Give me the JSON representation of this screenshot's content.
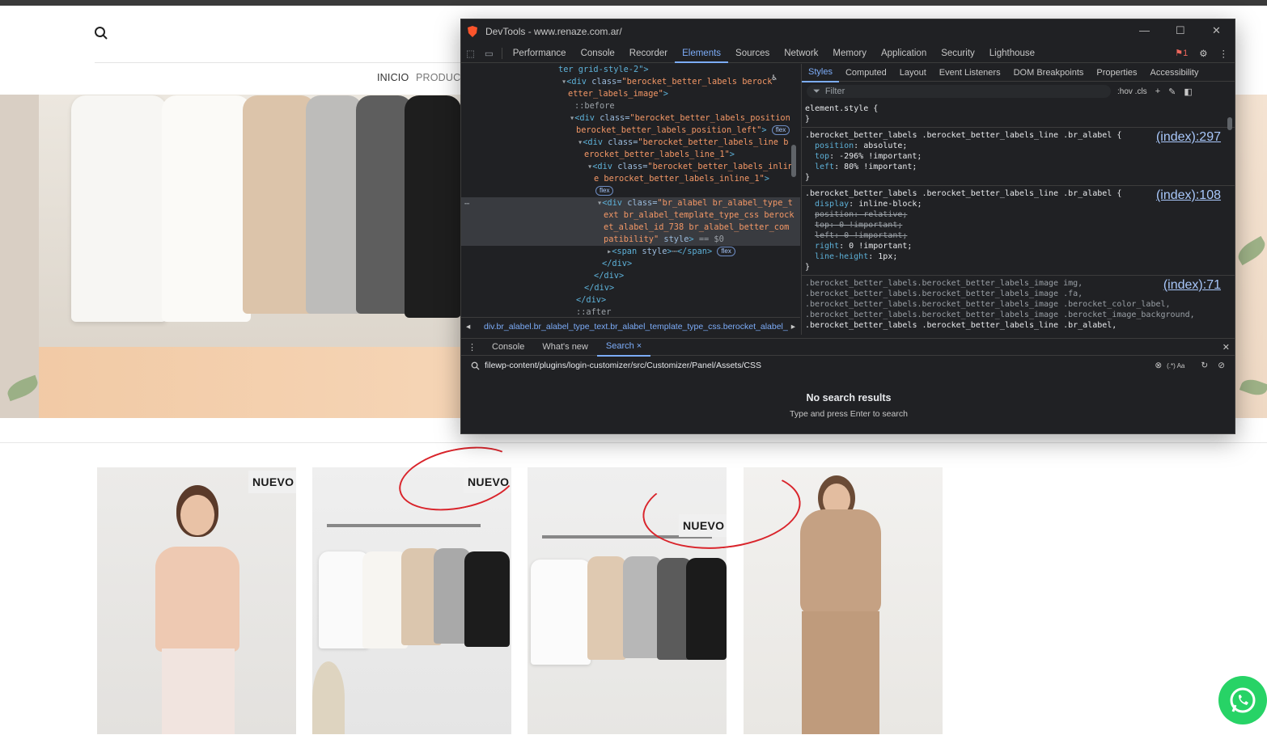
{
  "site": {
    "nav": [
      "INICIO",
      "PRODUCTO"
    ],
    "badges": [
      "NUEVO",
      "NUEVO",
      "NUEVO"
    ]
  },
  "devtools": {
    "title": "DevTools - www.renaze.com.ar/",
    "tabs": [
      "Performance",
      "Console",
      "Recorder",
      "Elements",
      "Sources",
      "Network",
      "Memory",
      "Application",
      "Security",
      "Lighthouse"
    ],
    "issues_count": "1",
    "elements": [
      {
        "indent": 120,
        "html": "<span class='tag'>ter grid-style-2\"&gt;</span>"
      },
      {
        "indent": 124,
        "html": "<span class='gr'>▾</span><span class='tag'>&lt;div</span> <span class='att'>class=</span><span class='val'>\"berocket_better_labels berock</span>"
      },
      {
        "indent": 132,
        "html": "<span class='val'>etter_labels_image\"</span><span class='tag'>&gt;</span>"
      },
      {
        "indent": 140,
        "html": "<span class='gr'>::before</span>"
      },
      {
        "indent": 134,
        "html": "<span class='gr'>▾</span><span class='tag'>&lt;div</span> <span class='att'>class=</span><span class='val'>\"berocket_better_labels_position</span>"
      },
      {
        "indent": 142,
        "html": "<span class='val'>berocket_better_labels_position_left\"</span><span class='tag'>&gt;</span> <span class='pill'>flex</span>"
      },
      {
        "indent": 144,
        "html": "<span class='gr'>▾</span><span class='tag'>&lt;div</span> <span class='att'>class=</span><span class='val'>\"berocket_better_labels_line b</span>"
      },
      {
        "indent": 152,
        "html": "<span class='val'>erocket_better_labels_line_1\"</span><span class='tag'>&gt;</span>"
      },
      {
        "indent": 156,
        "html": "<span class='gr'>▾</span><span class='tag'>&lt;div</span> <span class='att'>class=</span><span class='val'>\"berocket_better_labels_inlin</span>"
      },
      {
        "indent": 164,
        "html": "<span class='val'>e berocket_better_labels_inline_1\"</span><span class='tag'>&gt;</span>"
      },
      {
        "indent": 166,
        "html": "<span class='pill'>flex</span>"
      },
      {
        "indent": 168,
        "sel": true,
        "html": "<span class='gr'>▾</span><span class='tag'>&lt;div</span> <span class='att'>class=</span><span class='val'>\"br_alabel br_alabel_type_t</span>"
      },
      {
        "indent": 176,
        "sel": true,
        "html": "<span class='val'>ext br_alabel_template_type_css berock</span>"
      },
      {
        "indent": 176,
        "sel": true,
        "html": "<span class='val'>et_alabel_id_738  br_alabel_better_com</span>"
      },
      {
        "indent": 176,
        "sel": true,
        "html": "<span class='val'>patibility\"</span> <span class='att'>style</span><span class='tag'>&gt;</span> <span class='gr'>== $0</span>"
      },
      {
        "indent": 180,
        "html": "<span class='gr'>▸</span><span class='tag'>&lt;span</span> <span class='att'>style</span><span class='tag'>&gt;</span><span class='gr'>⋯</span><span class='tag'>&lt;/span&gt;</span> <span class='pill'>flex</span>"
      },
      {
        "indent": 174,
        "html": "<span class='tag'>&lt;/div&gt;</span>"
      },
      {
        "indent": 164,
        "html": "<span class='tag'>&lt;/div&gt;</span>"
      },
      {
        "indent": 152,
        "html": "<span class='tag'>&lt;/div&gt;</span>"
      },
      {
        "indent": 142,
        "html": "<span class='tag'>&lt;/div&gt;</span>"
      },
      {
        "indent": 142,
        "html": "<span class='gr'>::after</span>"
      }
    ],
    "breadcrumb": "div.br_alabel.br_alabel_type_text.br_alabel_template_type_css.berocket_alabel_",
    "styles_tabs": [
      "Styles",
      "Computed",
      "Layout",
      "Event Listeners",
      "DOM Breakpoints",
      "Properties",
      "Accessibility"
    ],
    "filter_placeholder": "Filter",
    "filter_tools": ":hov  .cls",
    "rules": [
      {
        "selector": "element.style {",
        "source": "",
        "lines": [],
        "close": "}"
      },
      {
        "selector": ".berocket_better_labels .berocket_better_labels_line .br_alabel {",
        "source": "(index):297",
        "lines": [
          {
            "p": "position",
            "v": "absolute;",
            "s": false
          },
          {
            "p": "top",
            "v": "-296% !important;",
            "s": false
          },
          {
            "p": "left",
            "v": "80% !important;",
            "s": false
          }
        ],
        "close": "}"
      },
      {
        "selector": ".berocket_better_labels .berocket_better_labels_line .br_alabel {",
        "source": "(index):108",
        "lines": [
          {
            "p": "display",
            "v": "inline-block;",
            "s": false
          },
          {
            "p": "position",
            "v": "relative;",
            "s": true
          },
          {
            "p": "top",
            "v": "0 !important;",
            "s": true
          },
          {
            "p": "left",
            "v": "0 !important;",
            "s": true
          },
          {
            "p": "right",
            "v": "0 !important;",
            "s": false
          },
          {
            "p": "line-height",
            "v": "1px;",
            "s": false
          }
        ],
        "close": "}"
      }
    ],
    "gray_selectors": [
      ".berocket_better_labels.berocket_better_labels_image img,",
      ".berocket_better_labels.berocket_better_labels_image .fa,",
      ".berocket_better_labels.berocket_better_labels_image .berocket_color_label,",
      ".berocket_better_labels.berocket_better_labels_image .berocket_image_background,",
      ".berocket_better_labels .berocket_better_labels_line .br_alabel,"
    ],
    "gray_source": "(index):71",
    "drawer_tabs": [
      "Console",
      "What's new",
      "Search"
    ],
    "search_query": "filewp-content/plugins/login-customizer/src/Customizer/Panel/Assets/CSS",
    "search_opts": "(.*)  Aa",
    "no_results": "No search results",
    "no_results_hint": "Type and press Enter to search"
  }
}
